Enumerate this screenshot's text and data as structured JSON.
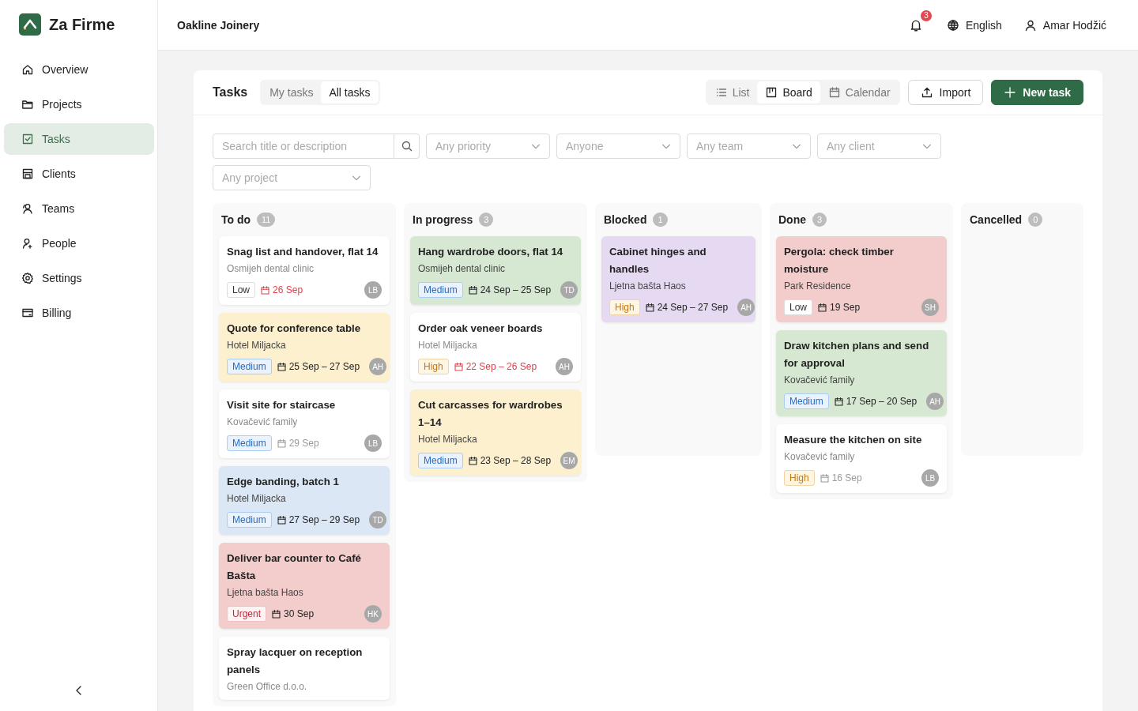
{
  "app": {
    "name": "Za Firme"
  },
  "sidebar": {
    "items": [
      {
        "label": "Overview",
        "selected": false
      },
      {
        "label": "Projects",
        "selected": false
      },
      {
        "label": "Tasks",
        "selected": true
      },
      {
        "label": "Clients",
        "selected": false
      },
      {
        "label": "Teams",
        "selected": false
      },
      {
        "label": "People",
        "selected": false
      },
      {
        "label": "Settings",
        "selected": false
      },
      {
        "label": "Billing",
        "selected": false
      }
    ]
  },
  "header": {
    "company": "Oakline Joinery",
    "notifications": "3",
    "language": "English",
    "user": "Amar Hodžić"
  },
  "panel": {
    "title": "Tasks",
    "scope_tabs": [
      {
        "label": "My tasks",
        "selected": false
      },
      {
        "label": "All tasks",
        "selected": true
      }
    ],
    "views": [
      {
        "label": "List",
        "selected": false
      },
      {
        "label": "Board",
        "selected": true
      },
      {
        "label": "Calendar",
        "selected": false
      }
    ],
    "import_button": "Import",
    "new_button": "New task"
  },
  "filters": {
    "search": {
      "placeholder": "Search title or description"
    },
    "selects": [
      {
        "placeholder": "Any priority"
      },
      {
        "placeholder": "Anyone"
      },
      {
        "placeholder": "Any team"
      },
      {
        "placeholder": "Any client"
      },
      {
        "placeholder": "Any project"
      }
    ]
  },
  "columns": [
    {
      "title": "To do",
      "count": "11",
      "cards": [
        {
          "title": "Snag list and handover, flat 14",
          "client": "Osmijeh dental clinic",
          "color": "#ffffff",
          "priority": {
            "label": "Low",
            "kind": "low"
          },
          "date": "26 Sep",
          "overdue": true,
          "faded": false,
          "assignee": "LB"
        },
        {
          "title": "Quote for conference table",
          "client": "Hotel Miljacka",
          "color": "#fdf0cf",
          "priority": {
            "label": "Medium",
            "kind": "medium"
          },
          "date": "25 Sep – 27 Sep",
          "overdue": false,
          "faded": false,
          "assignee": "AH"
        },
        {
          "title": "Visit site for staircase",
          "client": "Kovačević family",
          "color": "#ffffff",
          "priority": {
            "label": "Medium",
            "kind": "medium"
          },
          "date": "29 Sep",
          "overdue": false,
          "faded": true,
          "assignee": "LB"
        },
        {
          "title": "Edge banding, batch 1",
          "client": "Hotel Miljacka",
          "color": "#dce7f5",
          "priority": {
            "label": "Medium",
            "kind": "medium"
          },
          "date": "27 Sep – 29 Sep",
          "overdue": false,
          "faded": false,
          "assignee": "TD"
        },
        {
          "title": "Deliver bar counter to Café Bašta",
          "client": "Ljetna bašta Haos",
          "color": "#f3cccc",
          "priority": {
            "label": "Urgent",
            "kind": "urgent"
          },
          "date": "30 Sep",
          "overdue": false,
          "faded": false,
          "assignee": "HK"
        },
        {
          "title": "Spray lacquer on reception panels",
          "client": "Green Office d.o.o.",
          "color": "#ffffff"
        }
      ]
    },
    {
      "title": "In progress",
      "count": "3",
      "cards": [
        {
          "title": "Hang wardrobe doors, flat 14",
          "client": "Osmijeh dental clinic",
          "color": "#d7e8d2",
          "priority": {
            "label": "Medium",
            "kind": "medium"
          },
          "date": "24 Sep – 25 Sep",
          "overdue": false,
          "faded": false,
          "assignee": "TD"
        },
        {
          "title": "Order oak veneer boards",
          "client": "Hotel Miljacka",
          "color": "#ffffff",
          "priority": {
            "label": "High",
            "kind": "high"
          },
          "date": "22 Sep – 26 Sep",
          "overdue": true,
          "faded": false,
          "assignee": "AH"
        },
        {
          "title": "Cut carcasses for wardrobes 1–14",
          "client": "Hotel Miljacka",
          "color": "#fdf0cf",
          "priority": {
            "label": "Medium",
            "kind": "medium"
          },
          "date": "23 Sep – 28 Sep",
          "overdue": false,
          "faded": false,
          "assignee": "EM"
        }
      ]
    },
    {
      "title": "Blocked",
      "count": "1",
      "cards": [
        {
          "title": "Cabinet hinges and handles",
          "client": "Ljetna bašta Haos",
          "color": "#e5daf2",
          "priority": {
            "label": "High",
            "kind": "high"
          },
          "date": "24 Sep – 27 Sep",
          "overdue": false,
          "faded": false,
          "assignee": "AH"
        }
      ]
    },
    {
      "title": "Done",
      "count": "3",
      "cards": [
        {
          "title": "Pergola: check timber moisture",
          "client": "Park Residence",
          "color": "#f3cccc",
          "priority": {
            "label": "Low",
            "kind": "low"
          },
          "date": "19 Sep",
          "overdue": false,
          "faded": false,
          "assignee": "SH"
        },
        {
          "title": "Draw kitchen plans and send for approval",
          "client": "Kovačević family",
          "color": "#d7e8d2",
          "priority": {
            "label": "Medium",
            "kind": "medium"
          },
          "date": "17 Sep – 20 Sep",
          "overdue": false,
          "faded": false,
          "assignee": "AH"
        },
        {
          "title": "Measure the kitchen on site",
          "client": "Kovačević family",
          "color": "#ffffff",
          "priority": {
            "label": "High",
            "kind": "high"
          },
          "date": "16 Sep",
          "overdue": false,
          "faded": true,
          "assignee": "LB"
        }
      ]
    },
    {
      "title": "Cancelled",
      "count": "0"
    }
  ]
}
